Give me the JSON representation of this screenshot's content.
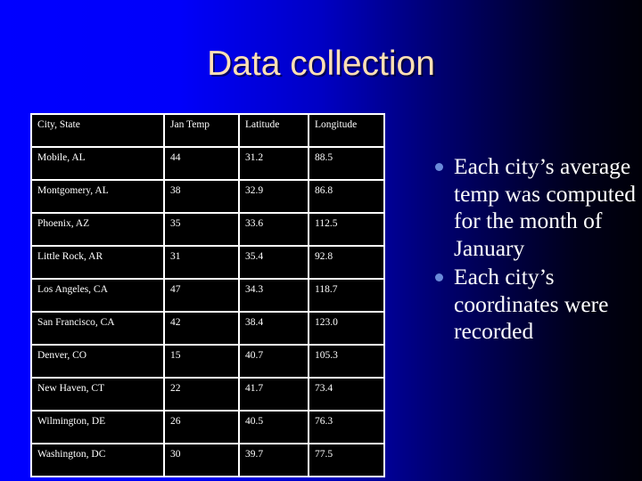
{
  "slide": {
    "title": "Data collection",
    "background": {
      "gradient_from": "#0000ff",
      "gradient_to": "#000008",
      "direction": "left-to-right"
    },
    "title_color": "#ffe0b5"
  },
  "table": {
    "headers": [
      "City, State",
      "Jan Temp",
      "Latitude",
      "Longitude"
    ],
    "rows": [
      [
        "Mobile, AL",
        "44",
        "31.2",
        "88.5"
      ],
      [
        "Montgomery, AL",
        "38",
        "32.9",
        "86.8"
      ],
      [
        "Phoenix, AZ",
        "35",
        "33.6",
        "112.5"
      ],
      [
        "Little Rock, AR",
        "31",
        "35.4",
        "92.8"
      ],
      [
        "Los Angeles, CA",
        "47",
        "34.3",
        "118.7"
      ],
      [
        "San Francisco, CA",
        "42",
        "38.4",
        "123.0"
      ],
      [
        "Denver, CO",
        "15",
        "40.7",
        "105.3"
      ],
      [
        "New Haven, CT",
        "22",
        "41.7",
        "73.4"
      ],
      [
        "Wilmington, DE",
        "26",
        "40.5",
        "76.3"
      ],
      [
        "Washington, DC",
        "30",
        "39.7",
        "77.5"
      ]
    ],
    "border_color": "#ffffff",
    "cell_background": "#000000",
    "text_color": "#ffffff"
  },
  "bullets": {
    "bullet_color": "#6a8ada",
    "items": [
      {
        "text": "Each city’s average temp was computed for the month of January"
      },
      {
        "text": "Each city’s coordinates were recorded"
      }
    ]
  }
}
